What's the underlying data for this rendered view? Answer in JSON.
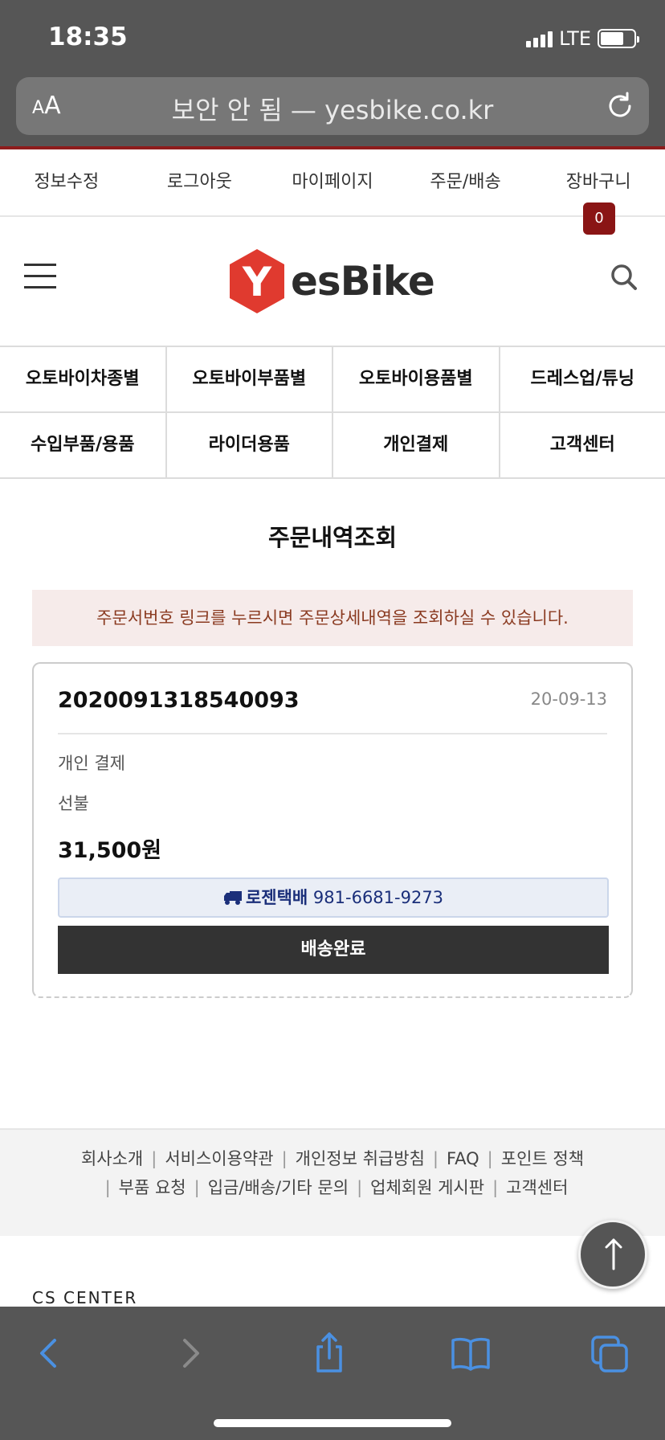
{
  "status_bar": {
    "time": "18:35",
    "network": "LTE"
  },
  "browser": {
    "aa_small": "A",
    "aa_big": "A",
    "url": "보안 안 됨 — yesbike.co.kr"
  },
  "top_links": [
    "정보수정",
    "로그아웃",
    "마이페이지",
    "주문/배송",
    "장바구니"
  ],
  "cart_count": "0",
  "logo": {
    "mark": "Y",
    "text": "esBike"
  },
  "categories": [
    [
      "오토바이차종별",
      "오토바이부품별",
      "오토바이용품별",
      "드레스업/튜닝"
    ],
    [
      "수입부품/용품",
      "라이더용품",
      "개인결제",
      "고객센터"
    ]
  ],
  "page_title": "주문내역조회",
  "notice": "주문서번호 링크를 누르시면 주문상세내역을 조회하실 수 있습니다.",
  "order": {
    "number": "2020091318540093",
    "date": "20-09-13",
    "payment_method": "개인 결제",
    "payment_type": "선불",
    "amount": "31,500원",
    "courier": "로젠택배",
    "tracking_number": "981-6681-9273",
    "status": "배송완료"
  },
  "footer_links": {
    "row1": [
      "회사소개",
      "서비스이용약관",
      "개인정보 취급방침",
      "FAQ",
      "포인트 정책"
    ],
    "row2": [
      "부품 요청",
      "입금/배송/기타 문의",
      "업체회원 게시판",
      "고객센터"
    ]
  },
  "cs_center": "CS CENTER",
  "colors": {
    "brand_red": "#e03a2f",
    "badge": "#8a1515",
    "notice_text": "#8a3a20",
    "toolbar_blue": "#4a90e2"
  }
}
